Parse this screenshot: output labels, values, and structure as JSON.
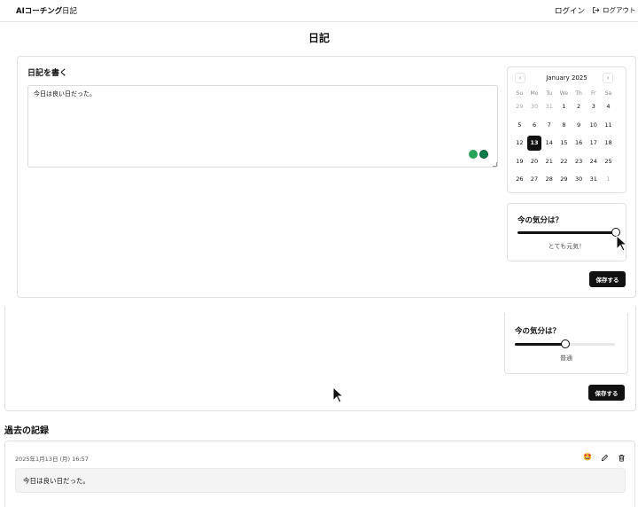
{
  "header": {
    "brand": "AIコーチング",
    "nav_diary": "日記",
    "login": "ログイン",
    "logout": "ログアウト"
  },
  "page_title": "日記",
  "write_card": {
    "heading": "日記を書く",
    "textarea_value": "今日は良い日だった。",
    "calendar": {
      "month_title": "January 2025",
      "weekdays": [
        "Su",
        "Mo",
        "Tu",
        "We",
        "Th",
        "Fr",
        "Sa"
      ],
      "weeks": [
        [
          "29",
          "30",
          "31",
          "1",
          "2",
          "3",
          "4"
        ],
        [
          "5",
          "6",
          "7",
          "8",
          "9",
          "10",
          "11"
        ],
        [
          "12",
          "13",
          "14",
          "15",
          "16",
          "17",
          "18"
        ],
        [
          "19",
          "20",
          "21",
          "22",
          "23",
          "24",
          "25"
        ],
        [
          "26",
          "27",
          "28",
          "29",
          "30",
          "31",
          "1"
        ]
      ],
      "selected_day": "13"
    },
    "mood": {
      "title": "今の気分は？",
      "value_label": "とても元気！",
      "level": 1.0
    },
    "save_label": "保存する"
  },
  "scrolled_card": {
    "mood": {
      "title": "今の気分は？",
      "value_label": "普通",
      "level": 0.5
    },
    "save_label": "保存する"
  },
  "past_records": {
    "title": "過去の記録",
    "entries": [
      {
        "date": "2025年1月13日 (月) 16:57",
        "mood_emoji": "🤩",
        "body": "今日は良い日だった。"
      }
    ]
  },
  "colors": {
    "primary": "#111111",
    "border": "#e2e2e2",
    "track_empty": "#e8e8e8",
    "entry_bg": "#f4f4f4"
  }
}
